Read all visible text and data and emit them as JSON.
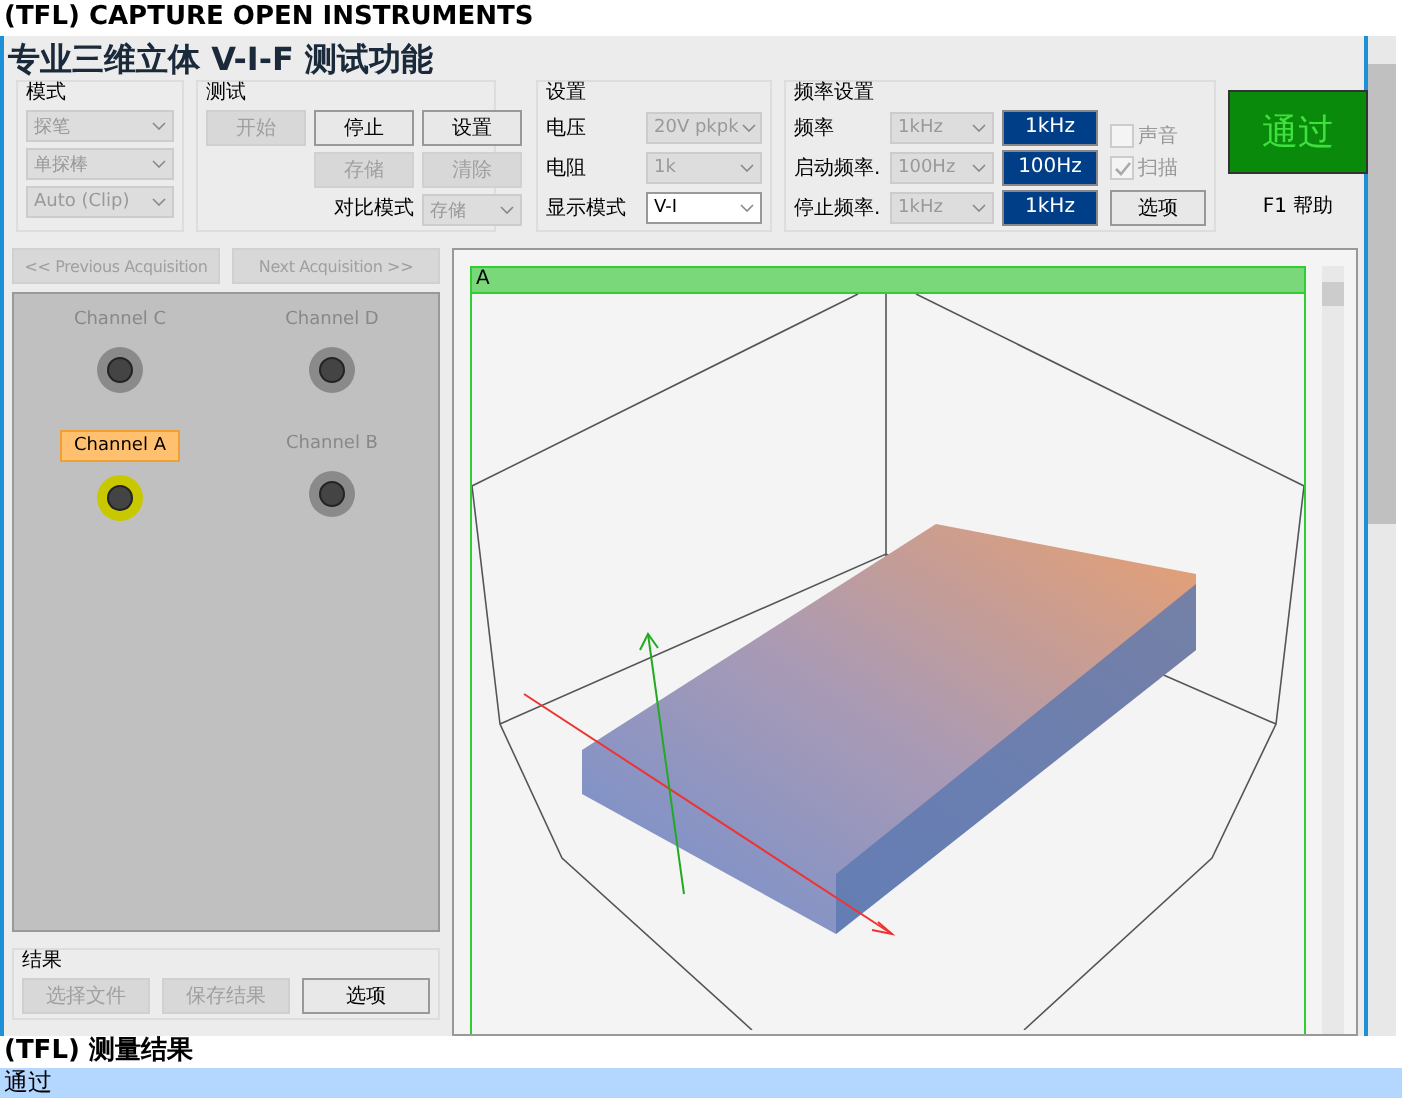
{
  "window": {
    "title": "(TFL) CAPTURE OPEN INSTRUMENTS"
  },
  "app_title": "专业三维立体 V-I-F 测试功能",
  "mode_group": {
    "label": "模式",
    "selects": [
      {
        "value": "探笔",
        "disabled": true
      },
      {
        "value": "单探棒",
        "disabled": true
      },
      {
        "value": "Auto (Clip)",
        "disabled": true
      }
    ]
  },
  "test_group": {
    "label": "测试",
    "buttons": [
      {
        "label": "开始",
        "disabled": true
      },
      {
        "label": "停止",
        "disabled": false
      },
      {
        "label": "设置",
        "disabled": false
      },
      {
        "label": "存储",
        "disabled": true
      },
      {
        "label": "清除",
        "disabled": true
      }
    ],
    "compare_label": "对比模式",
    "compare_select": {
      "value": "存储",
      "disabled": true
    }
  },
  "settings_group": {
    "label": "设置",
    "rows": [
      {
        "label": "电压",
        "value": "20V pkpk",
        "disabled": true
      },
      {
        "label": "电阻",
        "value": "1k",
        "disabled": true
      },
      {
        "label": "显示模式",
        "value": "V-I",
        "disabled": false
      }
    ]
  },
  "freq_group": {
    "label": "频率设置",
    "rows": [
      {
        "label": "频率",
        "value": "1kHz",
        "disabled": true,
        "display": "1kHz"
      },
      {
        "label": "启动频率.",
        "value": "100Hz",
        "disabled": true,
        "display": "100Hz"
      },
      {
        "label": "停止频率.",
        "value": "1kHz",
        "disabled": true,
        "display": "1kHz"
      }
    ],
    "checkboxes": [
      {
        "label": "声音",
        "checked": false,
        "disabled": true
      },
      {
        "label": "扫描",
        "checked": true,
        "disabled": true
      }
    ],
    "options_button": "选项"
  },
  "status_badge": "通过",
  "help": "F1 帮助",
  "nav_buttons": [
    {
      "label": "<< Previous Acquisition",
      "disabled": true
    },
    {
      "label": "Next Acquisition >>",
      "disabled": true
    }
  ],
  "channels": [
    {
      "label": "Channel C",
      "selected": false
    },
    {
      "label": "Channel D",
      "selected": false
    },
    {
      "label": "Channel A",
      "selected": true
    },
    {
      "label": "Channel B",
      "selected": false
    }
  ],
  "results": {
    "label": "结果",
    "buttons": [
      {
        "label": "选择文件",
        "disabled": true
      },
      {
        "label": "保存结果",
        "disabled": true
      },
      {
        "label": "选项",
        "disabled": false
      }
    ]
  },
  "plot": {
    "title": "A"
  },
  "output": {
    "title": "(TFL) 测量结果",
    "lines": [
      {
        "text": "通过",
        "selected": true
      }
    ]
  }
}
